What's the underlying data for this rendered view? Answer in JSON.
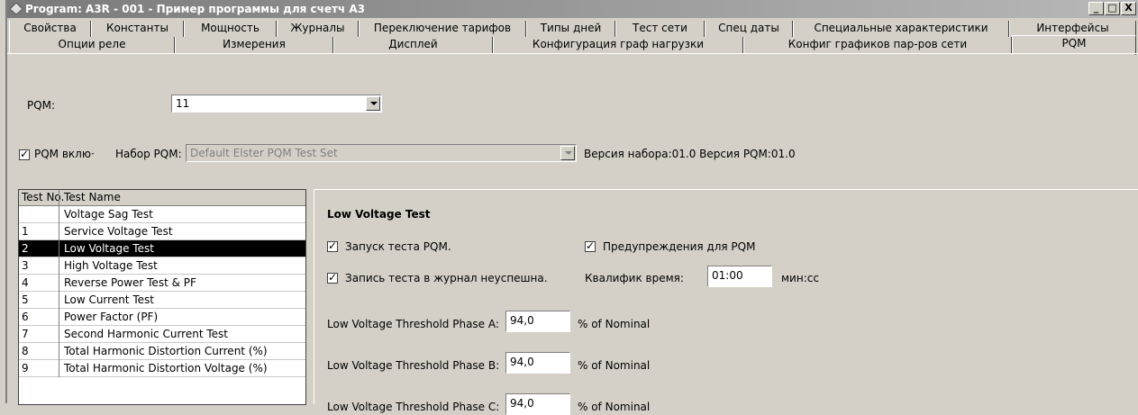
{
  "window": {
    "title": "Program: A3R - 001 - Пример программы для счетч А3",
    "min_label": "_",
    "max_label": "□",
    "close_label": "X"
  },
  "tabs_row1": [
    "Свойства",
    "Константы",
    "Мощность",
    "Журналы",
    "Переключение тарифов",
    "Типы дней",
    "Тест сети",
    "Спец даты",
    "Специальные характеристики",
    "Интерфейсы"
  ],
  "tabs_row2": [
    "Опции реле",
    "Измерения",
    "Дисплей",
    "Конфигурация граф нагрузки",
    "Конфиг графиков пар-ров сети",
    "PQM"
  ],
  "pqm": {
    "label": "PQM:",
    "value": "11",
    "enable_label": "PQM вклю·",
    "set_label": "Набор PQM:",
    "set_value": "Default Elster PQM Test Set",
    "version_text": "Версия набора:01.0 Версия PQM:01.0"
  },
  "test_list": {
    "col_no": "Test No.",
    "col_name": "Test Name",
    "rows": [
      {
        "no": "",
        "name": "Voltage Sag Test"
      },
      {
        "no": "1",
        "name": "Service Voltage Test"
      },
      {
        "no": "2",
        "name": "Low Voltage Test"
      },
      {
        "no": "3",
        "name": "High Voltage Test"
      },
      {
        "no": "4",
        "name": "Reverse Power Test & PF"
      },
      {
        "no": "5",
        "name": "Low Current Test"
      },
      {
        "no": "6",
        "name": "Power Factor (PF)"
      },
      {
        "no": "7",
        "name": "Second Harmonic Current Test"
      },
      {
        "no": "8",
        "name": "Total Harmonic Distortion Current (%)"
      },
      {
        "no": "9",
        "name": "Total Harmonic Distortion Voltage (%)"
      }
    ]
  },
  "detail": {
    "title": "Low Voltage Test",
    "run_label": "Запуск теста PQM.",
    "warn_label": "Предупреждения для PQM",
    "log_label": "Запись теста в журнал неуспешна.",
    "qual_label": "Квалифик время:",
    "qual_value": "01:00",
    "qual_unit": "мин:сс",
    "phase_a_label": "Low Voltage Threshold Phase A:",
    "phase_a_value": "94,0",
    "phase_a_unit": "% of Nominal",
    "phase_b_label": "Low Voltage Threshold Phase B:",
    "phase_b_value": "94,0",
    "phase_b_unit": "% of Nominal",
    "phase_c_label": "Low Voltage Threshold Phase C:",
    "phase_c_value": "94,0",
    "phase_c_unit": "% of Nominal"
  }
}
